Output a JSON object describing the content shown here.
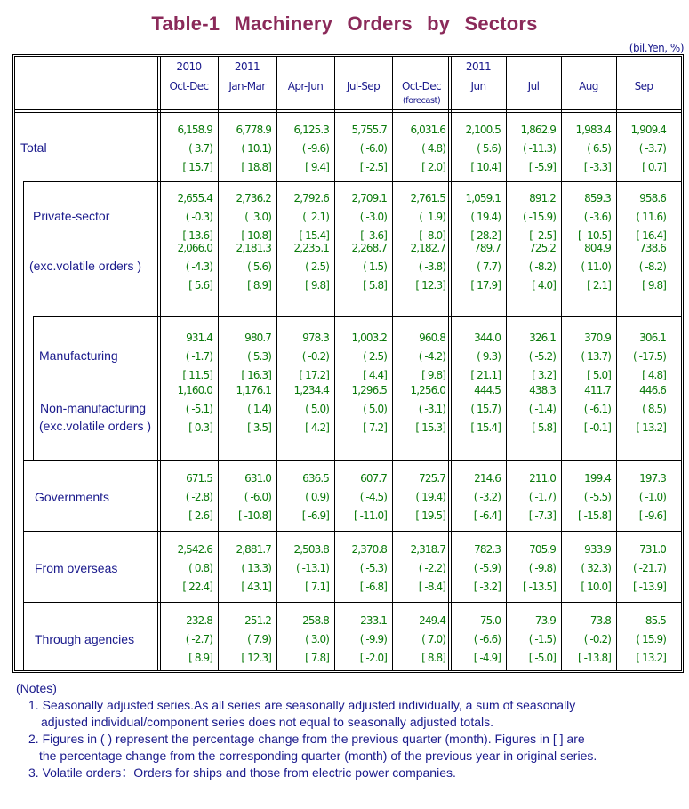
{
  "title": "Table-1   Machinery   Orders   by   Sectors",
  "unit": "(bil.Yen, %)",
  "columns": [
    {
      "year": "2010",
      "period": "Oct-Dec",
      "note": ""
    },
    {
      "year": "2011",
      "period": "Jan-Mar",
      "note": ""
    },
    {
      "year": "",
      "period": "Apr-Jun",
      "note": ""
    },
    {
      "year": "",
      "period": "Jul-Sep",
      "note": ""
    },
    {
      "year": "",
      "period": "Oct-Dec",
      "note": "(forecast)"
    },
    {
      "year": "2011",
      "period": "Jun",
      "note": ""
    },
    {
      "year": "",
      "period": "Jul",
      "note": ""
    },
    {
      "year": "",
      "period": "Aug",
      "note": ""
    },
    {
      "year": "",
      "period": "Sep",
      "note": ""
    }
  ],
  "rows": [
    {
      "label": "Total",
      "label2": "",
      "values": [
        "6,158.9",
        "6,778.9",
        "6,125.3",
        "5,755.7",
        "6,031.6",
        "2,100.5",
        "1,862.9",
        "1,983.4",
        "1,909.4"
      ],
      "qoq": [
        "( 3.7)",
        "( 10.1)",
        "( -9.6)",
        "( -6.0)",
        "( 4.8)",
        "( 5.6)",
        "( -11.3)",
        "( 6.5)",
        "( -3.7)"
      ],
      "yoy": [
        "[ 15.7]",
        "[ 18.8]",
        "[ 9.4]",
        "[ -2.5]",
        "[ 2.0]",
        "[ 10.4]",
        "[ -5.9]",
        "[ -3.3]",
        "[ 0.7]"
      ]
    },
    {
      "label": "Private-sector",
      "label2": "",
      "values": [
        "2,655.4",
        "2,736.2",
        "2,792.6",
        "2,709.1",
        "2,761.5",
        "1,059.1",
        "891.2",
        "859.3",
        "958.6"
      ],
      "qoq": [
        "( -0.3)",
        "(  3.0)",
        "(  2.1)",
        "( -3.0)",
        "(  1.9)",
        "( 19.4)",
        "( -15.9)",
        "( -3.6)",
        "( 11.6)"
      ],
      "yoy": [
        "[ 13.6]",
        "[ 10.8]",
        "[ 15.4]",
        "[  3.6]",
        "[  8.0]",
        "[ 28.2]",
        "[  2.5]",
        "[ -10.5]",
        "[ 16.4]"
      ]
    },
    {
      "label": "(exc.volatile orders )",
      "label2": "",
      "values": [
        "2,066.0",
        "2,181.3",
        "2,235.1",
        "2,268.7",
        "2,182.7",
        "789.7",
        "725.2",
        "804.9",
        "738.6"
      ],
      "qoq": [
        "( -4.3)",
        "( 5.6)",
        "( 2.5)",
        "( 1.5)",
        "( -3.8)",
        "( 7.7)",
        "( -8.2)",
        "( 11.0)",
        "( -8.2)"
      ],
      "yoy": [
        "[ 5.6]",
        "[ 8.9]",
        "[ 9.8]",
        "[ 5.8]",
        "[ 12.3]",
        "[ 17.9]",
        "[ 4.0]",
        "[ 2.1]",
        "[ 9.8]"
      ]
    },
    {
      "label": "Manufacturing",
      "label2": "",
      "values": [
        "931.4",
        "980.7",
        "978.3",
        "1,003.2",
        "960.8",
        "344.0",
        "326.1",
        "370.9",
        "306.1"
      ],
      "qoq": [
        "( -1.7)",
        "( 5.3)",
        "( -0.2)",
        "( 2.5)",
        "( -4.2)",
        "( 9.3)",
        "( -5.2)",
        "( 13.7)",
        "( -17.5)"
      ],
      "yoy": [
        "[ 11.5]",
        "[ 16.3]",
        "[ 17.2]",
        "[ 4.4]",
        "[ 9.8]",
        "[ 21.1]",
        "[ 3.2]",
        "[ 5.0]",
        "[ 4.8]"
      ]
    },
    {
      "label": "Non-manufacturing",
      "label2": "(exc.volatile orders )",
      "values": [
        "1,160.0",
        "1,176.1",
        "1,234.4",
        "1,296.5",
        "1,256.0",
        "444.5",
        "438.3",
        "411.7",
        "446.6"
      ],
      "qoq": [
        "( -5.1)",
        "( 1.4)",
        "( 5.0)",
        "( 5.0)",
        "( -3.1)",
        "( 15.7)",
        "( -1.4)",
        "( -6.1)",
        "( 8.5)"
      ],
      "yoy": [
        "[ 0.3]",
        "[ 3.5]",
        "[ 4.2]",
        "[ 7.2]",
        "[ 15.3]",
        "[ 15.4]",
        "[ 5.8]",
        "[ -0.1]",
        "[ 13.2]"
      ]
    },
    {
      "label": "Governments",
      "label2": "",
      "values": [
        "671.5",
        "631.0",
        "636.5",
        "607.7",
        "725.7",
        "214.6",
        "211.0",
        "199.4",
        "197.3"
      ],
      "qoq": [
        "( -2.8)",
        "( -6.0)",
        "( 0.9)",
        "( -4.5)",
        "( 19.4)",
        "( -3.2)",
        "( -1.7)",
        "( -5.5)",
        "( -1.0)"
      ],
      "yoy": [
        "[ 2.6]",
        "[ -10.8]",
        "[ -6.9]",
        "[ -11.0]",
        "[ 19.5]",
        "[ -6.4]",
        "[ -7.3]",
        "[ -15.8]",
        "[ -9.6]"
      ]
    },
    {
      "label": "From overseas",
      "label2": "",
      "values": [
        "2,542.6",
        "2,881.7",
        "2,503.8",
        "2,370.8",
        "2,318.7",
        "782.3",
        "705.9",
        "933.9",
        "731.0"
      ],
      "qoq": [
        "( 0.8)",
        "( 13.3)",
        "( -13.1)",
        "( -5.3)",
        "( -2.2)",
        "( -5.9)",
        "( -9.8)",
        "( 32.3)",
        "( -21.7)"
      ],
      "yoy": [
        "[ 22.4]",
        "[ 43.1]",
        "[ 7.1]",
        "[ -6.8]",
        "[ -8.4]",
        "[ -3.2]",
        "[ -13.5]",
        "[ 10.0]",
        "[ -13.9]"
      ]
    },
    {
      "label": "Through agencies",
      "label2": "",
      "values": [
        "232.8",
        "251.2",
        "258.8",
        "233.1",
        "249.4",
        "75.0",
        "73.9",
        "73.8",
        "85.5"
      ],
      "qoq": [
        "( -2.7)",
        "( 7.9)",
        "( 3.0)",
        "( -9.9)",
        "( 7.0)",
        "( -6.6)",
        "( -1.5)",
        "( -0.2)",
        "( 15.9)"
      ],
      "yoy": [
        "[ 8.9]",
        "[ 12.3]",
        "[ 7.8]",
        "[ -2.0]",
        "[ 8.8]",
        "[ -4.9]",
        "[ -5.0]",
        "[ -13.8]",
        "[ 13.2]"
      ]
    }
  ],
  "notes": {
    "heading": "(Notes)",
    "items": [
      {
        "line1": "1. Seasonally adjusted series.As all series are seasonally adjusted individually, a sum of seasonally",
        "line2": "adjusted individual/component series does not equal to seasonally adjusted totals."
      },
      {
        "line1": "2. Figures in ( ) represent the percentage change from the previous quarter (month). Figures in [ ] are",
        "line2": "the percentage change from the corresponding quarter (month) of the previous year in original series."
      },
      {
        "line1": "3. Volatile orders：Orders for ships and those from electric power companies.",
        "line2": ""
      }
    ]
  }
}
